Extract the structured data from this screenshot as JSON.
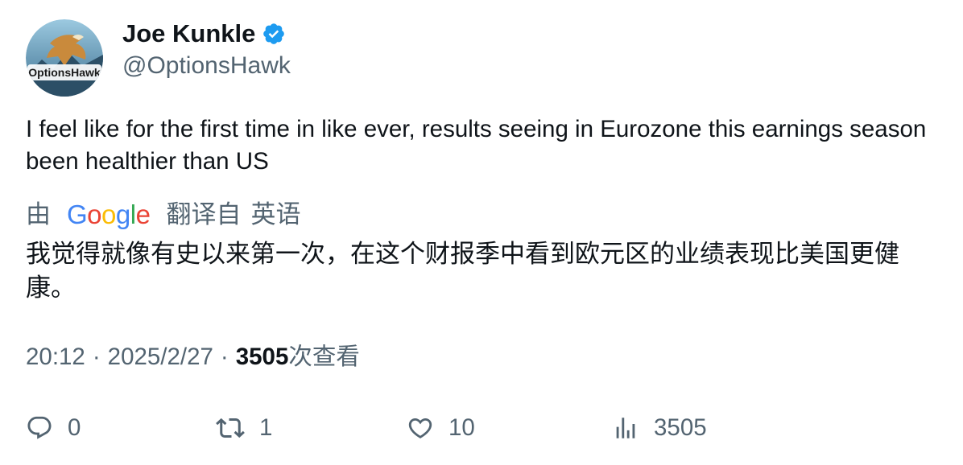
{
  "author": {
    "display_name": "Joe Kunkle",
    "handle": "@OptionsHawk",
    "avatar_icon": "options-hawk-logo",
    "avatar_text": "OptionsHawk",
    "verified": true,
    "verified_color": "#1d9bf0"
  },
  "tweet": {
    "text": "I feel like for the first time in like ever, results seeing in Eurozone this earnings season been healthier than US"
  },
  "translation": {
    "by_label": "由",
    "provider": "Google",
    "from_label": "翻译自",
    "language": "英语",
    "text": "我觉得就像有史以来第一次，在这个财报季中看到欧元区的业绩表现比美国更健康。"
  },
  "meta": {
    "time": "20:12",
    "separator": "·",
    "date": "2025/2/27",
    "views_count": "3505",
    "views_label": "次查看"
  },
  "actions": {
    "reply_count": "0",
    "retweet_count": "1",
    "like_count": "10",
    "views_count": "3505"
  },
  "colors": {
    "text_primary": "#0f1419",
    "text_secondary": "#536471",
    "google_blue": "#4285f4",
    "google_red": "#ea4335",
    "google_yellow": "#fbbc05",
    "google_green": "#34a853"
  }
}
